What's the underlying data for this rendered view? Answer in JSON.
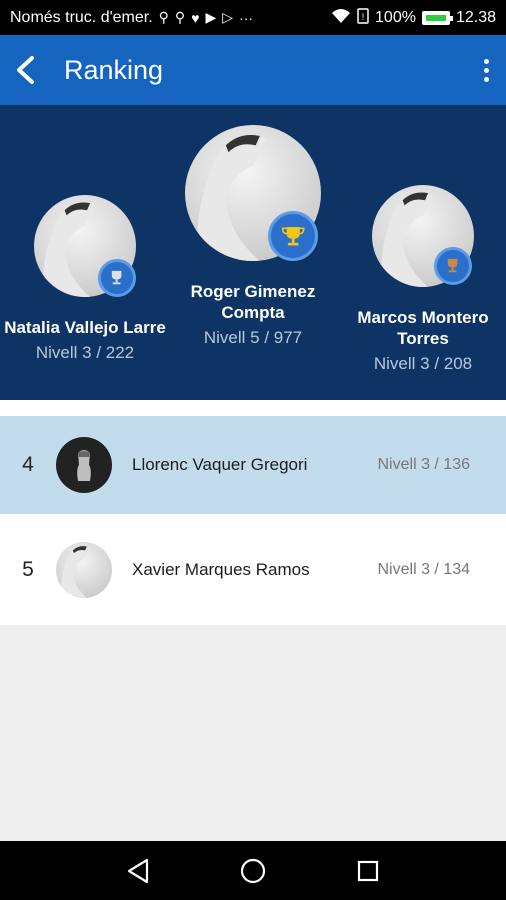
{
  "status_bar": {
    "left_text": "Només truc. d'emer.",
    "left_icons": [
      "usb-icon",
      "usb-icon",
      "health-icon",
      "play-store-icon",
      "play-icon",
      "more-icon"
    ],
    "battery": "100%",
    "time": "12.38"
  },
  "app_bar": {
    "title": "Ranking"
  },
  "podium": [
    {
      "place": 2,
      "name": "Natalia Vallejo Larre",
      "score": "Nivell 3 / 222",
      "trophy": "silver"
    },
    {
      "place": 1,
      "name": "Roger Gimenez Compta",
      "score": "Nivell 5 / 977",
      "trophy": "gold"
    },
    {
      "place": 3,
      "name": "Marcos Montero Torres",
      "score": "Nivell 3 / 208",
      "trophy": "bronze"
    }
  ],
  "list": [
    {
      "rank": "4",
      "name": "Llorenc Vaquer Gregori",
      "score": "Nivell 3 / 136",
      "highlight": true
    },
    {
      "rank": "5",
      "name": "Xavier Marques Ramos",
      "score": "Nivell 3 / 134",
      "highlight": false
    }
  ],
  "colors": {
    "app_bar": "#1565c0",
    "podium_bg": "#0d3464",
    "highlight_row": "#c3dcec"
  }
}
